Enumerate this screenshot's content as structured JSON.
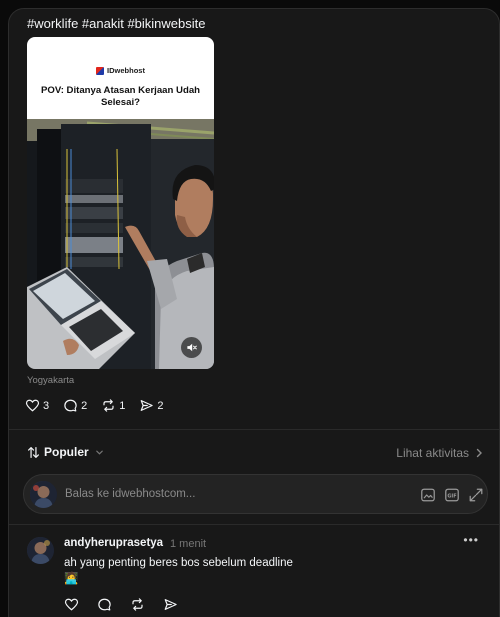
{
  "post": {
    "hashtags": "#worklife #anakit #bikinwebsite",
    "video": {
      "brand": "IDwebhost",
      "title": "POV: Ditanya Atasan Kerjaan Udah Selesai?",
      "muted": true
    },
    "location": "Yogyakarta",
    "stats": {
      "likes": "3",
      "replies": "2",
      "reposts": "1",
      "shares": "2"
    }
  },
  "replies_section": {
    "sort_label": "Populer",
    "activity_link": "Lihat aktivitas",
    "reply_placeholder": "Balas ke idwebhostcom..."
  },
  "comment": {
    "username": "andyheruprasetya",
    "time": "1 menit",
    "text": "ah yang penting beres bos sebelum deadline 🧑‍💻"
  },
  "colors": {
    "background": "#0a0a0a",
    "panel": "#181818",
    "text": "#f3f5f7",
    "muted": "#8a8a8a"
  }
}
